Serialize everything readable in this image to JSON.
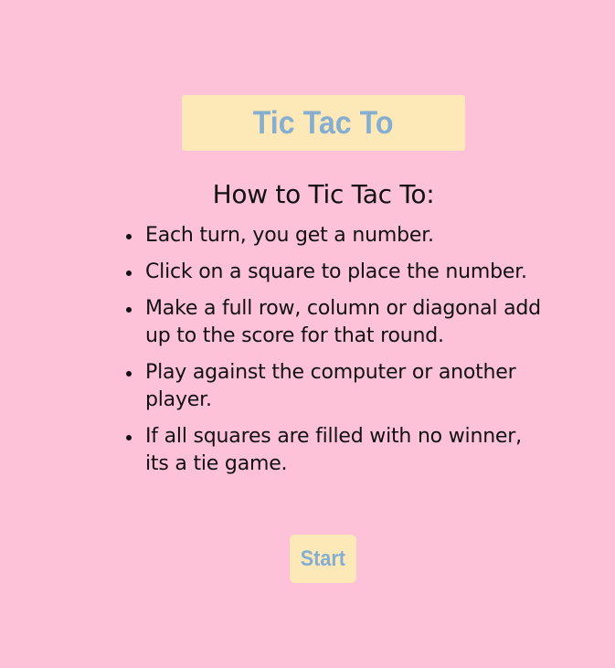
{
  "header": {
    "title": "Tic Tac To"
  },
  "instructions": {
    "heading": "How to Tic Tac To:",
    "rules": [
      "Each turn, you get a number.",
      "Click on a square to place the number.",
      "Make a full row, column or diagonal add up to the score for that round.",
      "Play against the computer or another player.",
      "If all squares are filled with no winner, its a tie game."
    ]
  },
  "actions": {
    "start_label": "Start"
  },
  "colors": {
    "background": "#fec2d8",
    "panel": "#fde8b7",
    "accent_text": "#85aed0",
    "body_text": "#111111"
  }
}
